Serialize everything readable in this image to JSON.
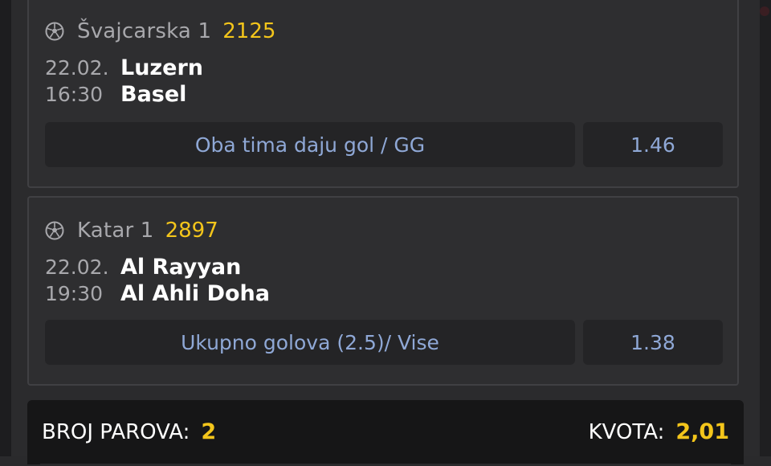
{
  "bets": [
    {
      "league": "Švajcarska 1",
      "code": "2125",
      "date": "22.02.",
      "time": "16:30",
      "home": "Luzern",
      "away": "Basel",
      "pick": "Oba tima daju gol / GG",
      "odd": "1.46",
      "icon": "soccer-ball-icon"
    },
    {
      "league": "Katar 1",
      "code": "2897",
      "date": "22.02.",
      "time": "19:30",
      "home": "Al Rayyan",
      "away": "Al Ahli Doha",
      "pick": "Ukupno golova (2.5)/ Vise",
      "odd": "1.38",
      "icon": "soccer-ball-icon"
    }
  ],
  "footer": {
    "pairs_label": "BROJ PAROVA:",
    "pairs_value": "2",
    "odds_label": "KVOTA:",
    "odds_value": "2,01"
  },
  "colors": {
    "accent": "#f3c51b",
    "pick_text": "#8fa8d6",
    "card_bg": "#2e2e30"
  }
}
